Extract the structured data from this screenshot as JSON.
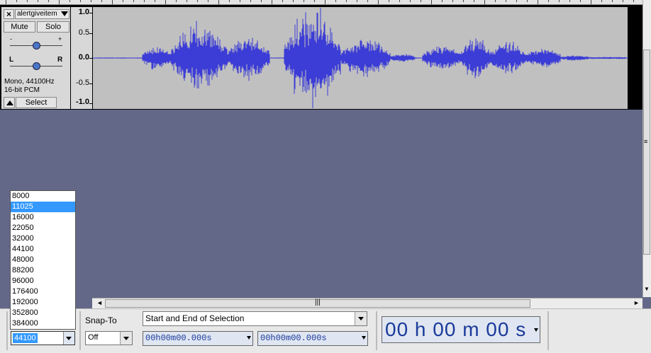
{
  "track": {
    "name": "alertgiveitem",
    "mute_label": "Mute",
    "solo_label": "Solo",
    "gain_minus": "-",
    "gain_plus": "+",
    "pan_left": "L",
    "pan_right": "R",
    "format_line1": "Mono, 44100Hz",
    "format_line2": "16-bit PCM",
    "select_label": "Select"
  },
  "amplitude_ruler": [
    "1.0",
    "0.5",
    "0.0",
    "-0.5",
    "-1.0"
  ],
  "sample_rate_list": {
    "options": [
      "8000",
      "11025",
      "16000",
      "22050",
      "32000",
      "44100",
      "48000",
      "88200",
      "96000",
      "176400",
      "192000",
      "352800",
      "384000"
    ],
    "highlighted": "11025",
    "current_value": "44100"
  },
  "selection_toolbar": {
    "snap_to_label": "Snap-To",
    "snap_value": "Off",
    "selection_mode": "Start and End of Selection",
    "start_time": "00h00m00.000s",
    "end_time": "00h00m00.000s"
  },
  "audio_position": "00 h 00 m 00 s",
  "colors": {
    "waveform": "#3c3cd6",
    "track_bg": "#c0c0c0",
    "project_bg": "#646888",
    "selection_highlight": "#3399ff"
  }
}
